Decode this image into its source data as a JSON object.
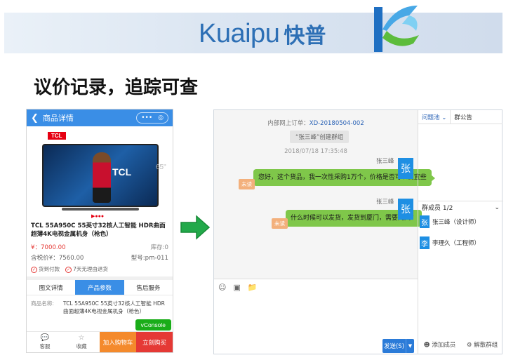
{
  "header": {
    "brand_en": "Kuaipu",
    "brand_cn": "快普",
    "accent": "#2d6fb5"
  },
  "slide_title": "议价记录，追踪可查",
  "phone": {
    "title": "商品详情",
    "back_icon": "chevron-left",
    "capsule_dots": "•••",
    "capsule_target": "◎",
    "tv_brand": "TCL",
    "tv_size": "65\"",
    "tv_screen_brand": "TCL",
    "product_name": "TCL 55A950C 55英寸32核人工智能 HDR曲面超薄4K电视金属机身（枪色）",
    "price": "¥：7000.00",
    "stock": "库存:0",
    "tax_price": "含税价¥：7560.00",
    "model": "型号:pm-011",
    "flags": [
      "货到付款",
      "7天无理由退货"
    ],
    "tabs": [
      "图文详情",
      "产品参数",
      "售后服务"
    ],
    "active_tab": 1,
    "detail_label": "商品名称:",
    "detail_value": "TCL 55A950C 55英寸32核人工智能 HDR曲面超薄4K电视金属机身（枪色）",
    "vconsole": "vConsole",
    "bottom": {
      "service": "客服",
      "favorite": "收藏",
      "cart": "加入购物车",
      "buy": "立刻购买"
    }
  },
  "chat": {
    "order_prefix": "内部网上订单：",
    "order_no": "XD-20180504-002",
    "notice": "“张三峰”创建群组",
    "time": "2018/07/18 17:35:48",
    "messages": [
      {
        "sender": "张三峰",
        "text": "您好，这个货品，我一次性采购1万个，价格是否可以便宜些",
        "status": "未读",
        "avatar": "张"
      },
      {
        "sender": "张三峰",
        "text": "什么时候可以发货，发货到厦门，需要几天？",
        "status": "未读",
        "avatar": "张"
      }
    ],
    "send_label": "发送(S)",
    "side": {
      "tabs": [
        "问题池",
        "群公告"
      ],
      "members_title": "群成员 1/2",
      "members": [
        {
          "avatar": "张",
          "name": "张三峰（设计师）"
        },
        {
          "avatar": "李",
          "name": "李理久（工程师）"
        }
      ],
      "add_member": "添加成员",
      "dissolve": "解散群组"
    }
  }
}
